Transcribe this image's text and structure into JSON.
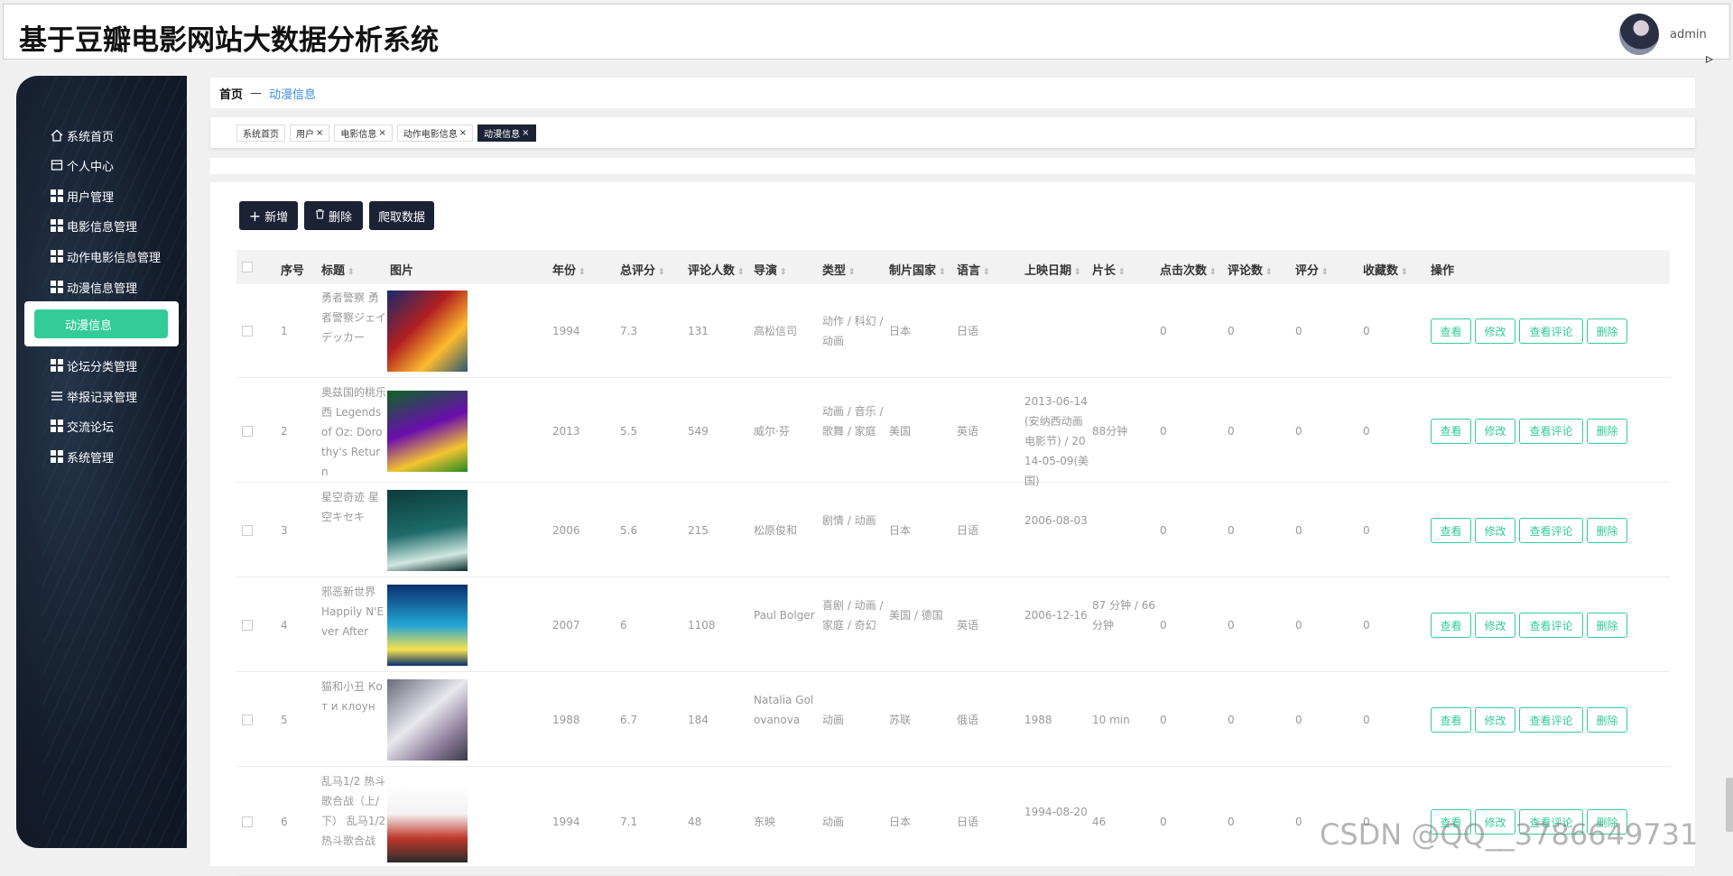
{
  "app": {
    "title": "基于豆瓣电影网站大数据分析系统",
    "user": "admin"
  },
  "sidebar": {
    "items": [
      {
        "label": "系统首页",
        "icon": "home-icon"
      },
      {
        "label": "个人中心",
        "icon": "profile-icon"
      },
      {
        "label": "用户管理",
        "icon": "grid-icon"
      },
      {
        "label": "电影信息管理",
        "icon": "grid-icon"
      },
      {
        "label": "动作电影信息管理",
        "icon": "grid-icon"
      },
      {
        "label": "动漫信息管理",
        "icon": "grid-icon"
      },
      {
        "label": "动漫信息",
        "icon": "",
        "active": true
      },
      {
        "label": "论坛分类管理",
        "icon": "grid-icon"
      },
      {
        "label": "举报记录管理",
        "icon": "list-icon"
      },
      {
        "label": "交流论坛",
        "icon": "grid-icon"
      },
      {
        "label": "系统管理",
        "icon": "grid-icon"
      }
    ]
  },
  "breadcrumb": {
    "home": "首页",
    "separator": "—",
    "current": "动漫信息"
  },
  "tabs": [
    {
      "label": "系统首页",
      "closable": false
    },
    {
      "label": "用户",
      "closable": true
    },
    {
      "label": "电影信息",
      "closable": true
    },
    {
      "label": "动作电影信息",
      "closable": true
    },
    {
      "label": "动漫信息",
      "closable": true,
      "active": true
    }
  ],
  "toolbar": {
    "add": "新增",
    "delete": "删除",
    "crawl": "爬取数据"
  },
  "table": {
    "headers": [
      "序号",
      "标题",
      "图片",
      "年份",
      "总评分",
      "评论人数",
      "导演",
      "类型",
      "制片国家",
      "语言",
      "上映日期",
      "片长",
      "点击次数",
      "评论数",
      "评分",
      "收藏数",
      "操作"
    ],
    "actions": [
      "查看",
      "修改",
      "查看评论",
      "删除"
    ],
    "rows": [
      {
        "no": "1",
        "title": "勇者警察 勇者警察ジェイデッカー",
        "year": "1994",
        "score": "7.3",
        "reviewers": "131",
        "director": "高松信司",
        "genre": "动作 / 科幻 / 动画",
        "country": "日本",
        "language": "日语",
        "release": "",
        "duration": "",
        "clicks": "0",
        "comments": "0",
        "rating": "0",
        "favorites": "0"
      },
      {
        "no": "2",
        "title": "奥兹国的桃乐西 Legends of Oz: Dorothy's Return",
        "year": "2013",
        "score": "5.5",
        "reviewers": "549",
        "director": "威尔·芬",
        "genre": "动画 / 音乐 / 歌舞 / 家庭",
        "country": "美国",
        "language": "英语",
        "release": "2013-06-14(安纳西动画电影节) / 2014-05-09(美国)",
        "duration": "88分钟",
        "clicks": "0",
        "comments": "0",
        "rating": "0",
        "favorites": "0"
      },
      {
        "no": "3",
        "title": "星空奇迹 星空キセキ",
        "year": "2006",
        "score": "5.6",
        "reviewers": "215",
        "director": "松原俊和",
        "genre": "剧情 / 动画",
        "country": "日本",
        "language": "日语",
        "release": "2006-08-03",
        "duration": "",
        "clicks": "0",
        "comments": "0",
        "rating": "0",
        "favorites": "0"
      },
      {
        "no": "4",
        "title": "邪恶新世界 Happily N'Ever After",
        "year": "2007",
        "score": "6",
        "reviewers": "1108",
        "director": "Paul Bolger",
        "genre": "喜剧 / 动画 / 家庭 / 奇幻",
        "country": "美国 / 德国",
        "language": "英语",
        "release": "2006-12-16",
        "duration": "87 分钟 / 66 分钟",
        "clicks": "0",
        "comments": "0",
        "rating": "0",
        "favorites": "0"
      },
      {
        "no": "5",
        "title": "猫和小丑 Кот и клоун",
        "year": "1988",
        "score": "6.7",
        "reviewers": "184",
        "director": "Natalia Golovanova",
        "genre": "动画",
        "country": "苏联",
        "language": "俄语",
        "release": "1988",
        "duration": "10 min",
        "clicks": "0",
        "comments": "0",
        "rating": "0",
        "favorites": "0"
      },
      {
        "no": "6",
        "title": "乱马1/2 热斗歌合战（上/下） 乱马1/2 热斗歌合战",
        "year": "1994",
        "score": "7.1",
        "reviewers": "48",
        "director": "东映",
        "genre": "动画",
        "country": "日本",
        "language": "日语",
        "release": "1994-08-20",
        "duration": "46",
        "clicks": "0",
        "comments": "0",
        "rating": "0",
        "favorites": "0"
      }
    ]
  },
  "watermark": "CSDN @QQ__3786649731",
  "colors": {
    "accent": "#33cc99",
    "dark": "#1c2236",
    "link": "#3a8ee6"
  }
}
